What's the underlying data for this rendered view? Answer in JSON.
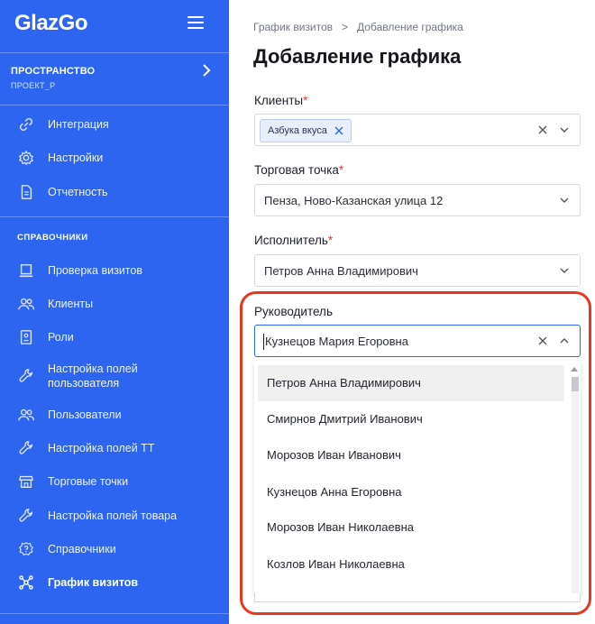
{
  "app": {
    "logo": "GlazGo"
  },
  "sidebar": {
    "workspace": {
      "title": "ПРОСТРАНСТВО",
      "subtitle": "ПРОЕКТ_Р"
    },
    "items_top": [
      {
        "label": "Интеграция",
        "icon": "link-icon"
      },
      {
        "label": "Настройки",
        "icon": "gear-icon"
      },
      {
        "label": "Отчетность",
        "icon": "document-icon"
      }
    ],
    "section_title": "СПРАВОЧНИКИ",
    "items": [
      {
        "label": "Проверка визитов",
        "icon": "laptop-icon"
      },
      {
        "label": "Клиенты",
        "icon": "clients-icon"
      },
      {
        "label": "Роли",
        "icon": "id-card-icon"
      },
      {
        "label": "Настройка полей пользователя",
        "icon": "wrench-icon"
      },
      {
        "label": "Пользователи",
        "icon": "users-icon"
      },
      {
        "label": "Настройка полей ТТ",
        "icon": "wrench-icon"
      },
      {
        "label": "Торговые точки",
        "icon": "store-icon"
      },
      {
        "label": "Настройка полей товара",
        "icon": "wrench-icon"
      },
      {
        "label": "Справочники",
        "icon": "help-icon"
      },
      {
        "label": "График визитов",
        "icon": "nodes-icon",
        "active": true
      }
    ]
  },
  "breadcrumb": {
    "parent": "График визитов",
    "separator": ">",
    "current": "Добавление графика"
  },
  "page": {
    "title": "Добавление графика"
  },
  "form": {
    "clients": {
      "label": "Клиенты",
      "required_mark": "*",
      "tags": [
        "Азбука вкуса"
      ]
    },
    "store": {
      "label": "Торговая точка",
      "required_mark": "*",
      "value": "Пенза, Ново-Казанская улица 12"
    },
    "executor": {
      "label": "Исполнитель",
      "required_mark": "*",
      "value": "Петров Анна Владимирович"
    },
    "manager": {
      "label": "Руководитель",
      "value": "Кузнецов Мария Егоровна",
      "options": [
        "Петров Анна Владимирович",
        "Смирнов Дмитрий Иванович",
        "Морозов Иван Иванович",
        "Кузнецов Анна Егоровна",
        "Морозов Иван Николаевна",
        "Козлов Иван Николаевна"
      ]
    }
  },
  "colors": {
    "sidebar": "#2d64f0",
    "highlight": "#e8361f",
    "required": "#e53935"
  }
}
